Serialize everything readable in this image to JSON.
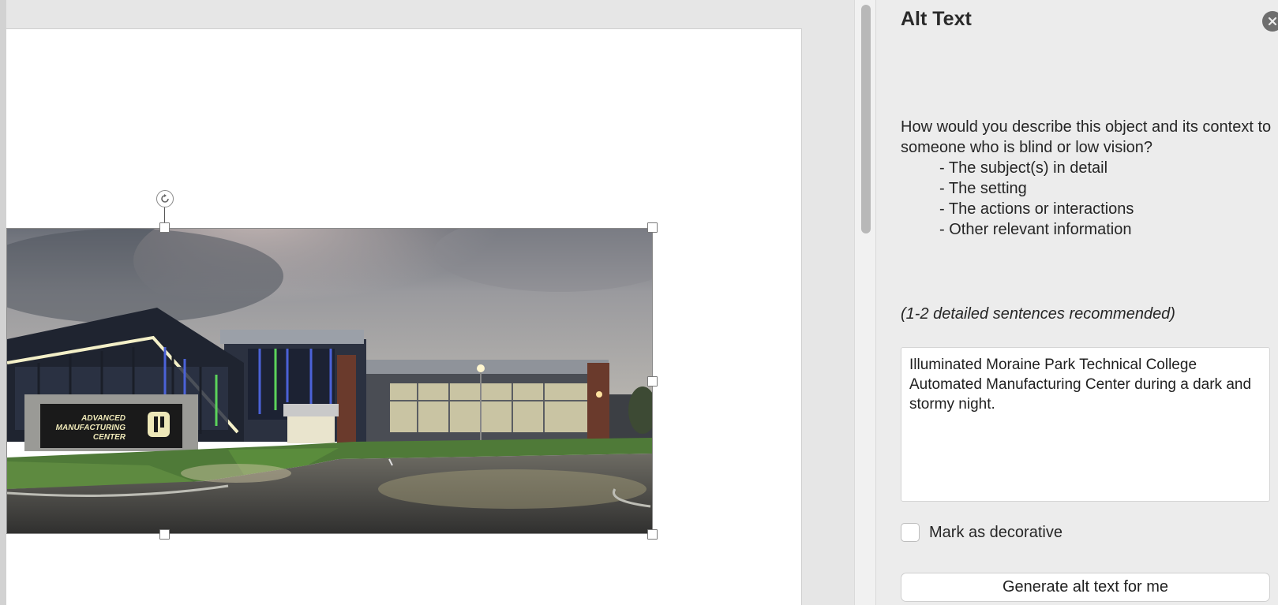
{
  "pane": {
    "title": "Alt Text",
    "close_icon": "close-icon",
    "prompt_question": "How would you describe this object and its context to someone who is blind or low vision?",
    "prompt_items": [
      "- The subject(s) in detail",
      "- The setting",
      "- The actions or interactions",
      "- Other relevant information"
    ],
    "hint": "(1-2 detailed sentences recommended)",
    "alt_text_value": "Illuminated Moraine Park Technical College Automated Manufacturing Center during a dark and stormy night.",
    "decorative_label": "Mark as decorative",
    "decorative_checked": false,
    "generate_button": "Generate alt text for me"
  },
  "picture": {
    "sign_line1": "ADVANCED",
    "sign_line2": "MANUFACTURING",
    "sign_line3": "CENTER",
    "rotate_icon": "rotate-icon"
  },
  "colors": {
    "pane_bg": "#ececec",
    "page_bg": "#ffffff",
    "canvas_bg": "#e6e6e6"
  }
}
